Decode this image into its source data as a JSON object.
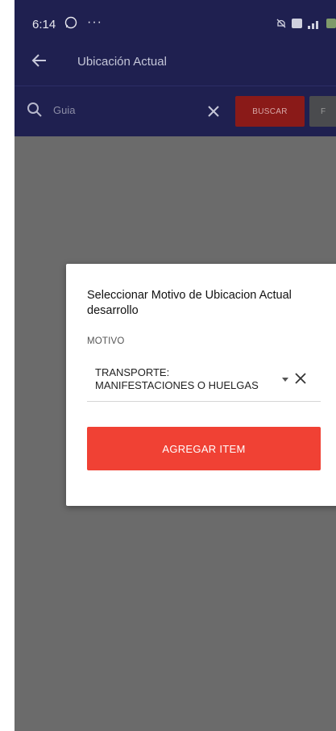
{
  "status_bar": {
    "time": "6:14",
    "dots": "···",
    "whatsapp_icon": "whatsapp-icon",
    "right_icons": [
      "muted-bell-icon",
      "nfc-icon",
      "signal-icon",
      "battery-icon"
    ]
  },
  "app_bar": {
    "title": "Ubicación Actual",
    "back_icon": "arrow-left-icon"
  },
  "search": {
    "placeholder": "Guia",
    "search_icon": "search-icon",
    "clear_icon": "close-icon",
    "buscar_label": "BUSCAR",
    "extra_label": "F"
  },
  "dialog": {
    "title": "Seleccionar Motivo de Ubicacion Actual desarrollo",
    "motivo_label": "MOTIVO",
    "selected_value_line1": "TRANSPORTE:",
    "selected_value_line2": "MANIFESTACIONES O HUELGAS",
    "add_button_label": "AGREGAR ITEM"
  },
  "colors": {
    "header_bg": "#1f2050",
    "overlay_bg": "#6b6b6b",
    "accent_red": "#f04134",
    "buscar_red_dimmed": "#8a1a18"
  }
}
